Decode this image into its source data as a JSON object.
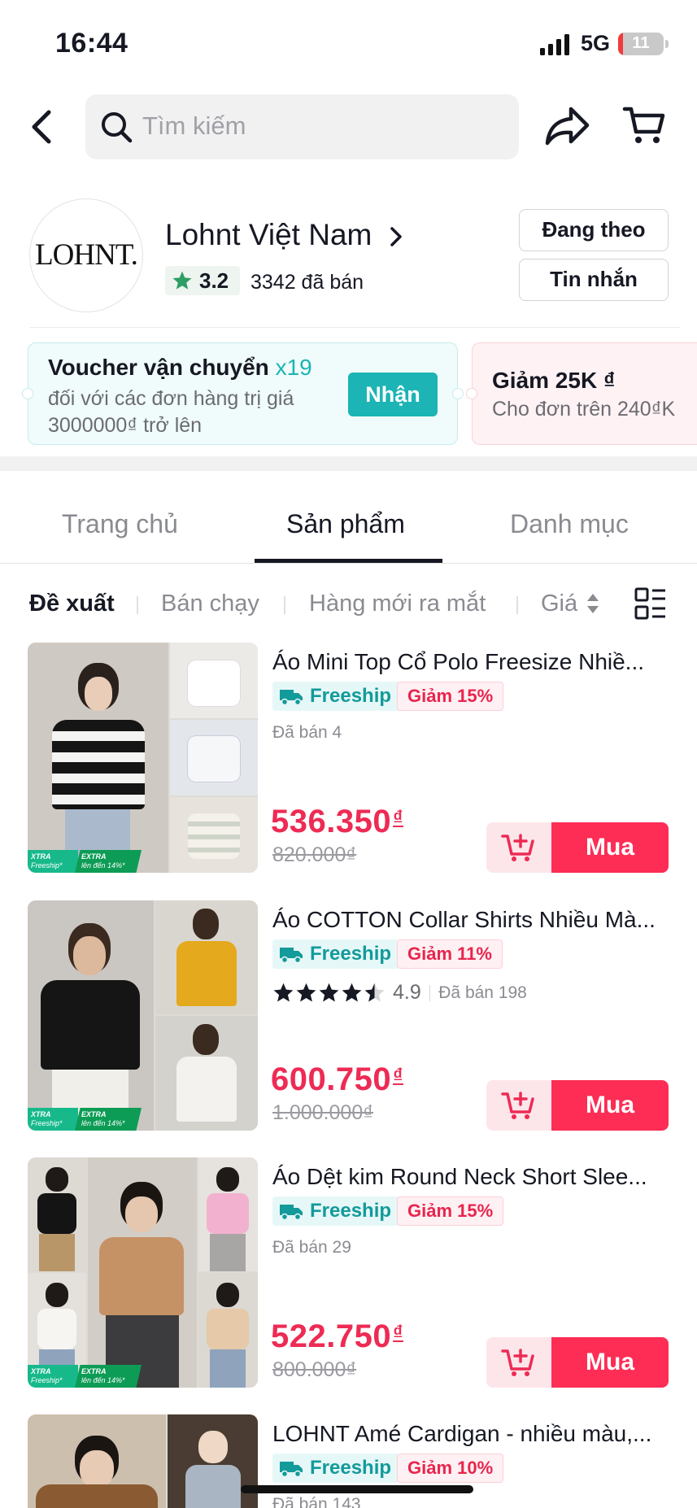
{
  "status_bar": {
    "time": "16:44",
    "network": "5G",
    "battery": "11",
    "battery_level": 0.11
  },
  "header": {
    "search_placeholder": "Tìm kiếm"
  },
  "shop": {
    "avatar_text": "LOHNT.",
    "name": "Lohnt Việt Nam",
    "rating": "3.2",
    "sold": "3342 đã bán",
    "follow_label": "Đang theo",
    "message_label": "Tin nhắn"
  },
  "vouchers": [
    {
      "title": "Voucher vận chuyển",
      "multiplier": "x19",
      "desc": "đối với các đơn hàng trị giá 3000000₫ trở lên",
      "button": "Nhận"
    },
    {
      "title": "Giảm 25K ₫",
      "desc": "Cho đơn trên 240₫K"
    }
  ],
  "tabs": [
    "Trang chủ",
    "Sản phẩm",
    "Danh mục"
  ],
  "sort": {
    "recommended": "Đề xuất",
    "best_selling": "Bán chạy",
    "new_arrivals": "Hàng mới ra mắt",
    "price": "Giá"
  },
  "labels": {
    "freeship": "Freeship",
    "buy": "Mua",
    "xtra": "XTRA",
    "xtra_sub": "Freeship*",
    "extra": "EXTRA",
    "extra_sub": "lên đến 14%*"
  },
  "products": [
    {
      "title": "Áo Mini Top Cổ Polo Freesize Nhiề...",
      "discount": "Giảm 15%",
      "sold": "Đã bán 4",
      "price": "536.350",
      "original": "820.000₫"
    },
    {
      "title": "Áo COTTON Collar Shirts Nhiều Mà...",
      "discount": "Giảm 11%",
      "rating": "4.9",
      "rating_value": 4.5,
      "sold": "Đã bán 198",
      "price": "600.750",
      "original": "1.000.000₫"
    },
    {
      "title": "Áo Dệt kim Round Neck Short Slee...",
      "discount": "Giảm 15%",
      "sold": "Đã bán 29",
      "price": "522.750",
      "original": "800.000₫"
    },
    {
      "title": "LOHNT Amé Cardigan - nhiều màu,...",
      "discount": "Giảm 10%",
      "sold": "Đã bán 143"
    }
  ],
  "currency_symbol": "₫",
  "colors": {
    "accent": "#fd2d55",
    "teal": "#1cb4b4",
    "price": "#ed2b54"
  }
}
